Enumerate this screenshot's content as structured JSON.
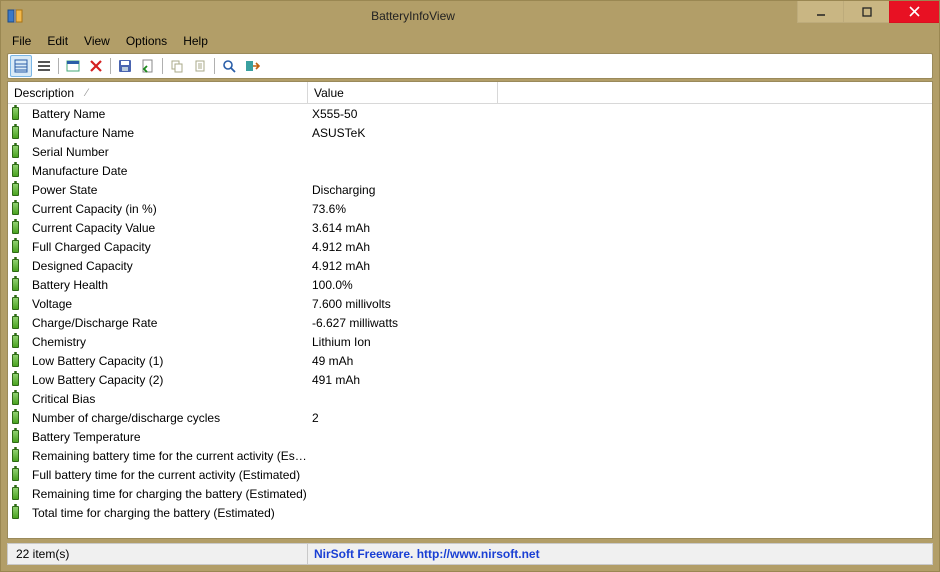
{
  "window": {
    "title": "BatteryInfoView"
  },
  "menu": {
    "file": "File",
    "edit": "Edit",
    "view": "View",
    "options": "Options",
    "help": "Help"
  },
  "columns": {
    "description": "Description",
    "value": "Value"
  },
  "rows": [
    {
      "desc": "Battery Name",
      "val": "X555-50"
    },
    {
      "desc": "Manufacture Name",
      "val": "ASUSTeK"
    },
    {
      "desc": "Serial Number",
      "val": ""
    },
    {
      "desc": "Manufacture Date",
      "val": ""
    },
    {
      "desc": "Power State",
      "val": "Discharging"
    },
    {
      "desc": "Current Capacity (in %)",
      "val": "73.6%"
    },
    {
      "desc": "Current Capacity Value",
      "val": "3.614 mAh"
    },
    {
      "desc": "Full Charged Capacity",
      "val": "4.912 mAh"
    },
    {
      "desc": "Designed Capacity",
      "val": "4.912 mAh"
    },
    {
      "desc": "Battery Health",
      "val": "100.0%"
    },
    {
      "desc": "Voltage",
      "val": "7.600 millivolts"
    },
    {
      "desc": "Charge/Discharge Rate",
      "val": "-6.627 milliwatts"
    },
    {
      "desc": "Chemistry",
      "val": "Lithium Ion"
    },
    {
      "desc": "Low Battery Capacity (1)",
      "val": "49 mAh"
    },
    {
      "desc": "Low Battery Capacity (2)",
      "val": "491 mAh"
    },
    {
      "desc": "Critical Bias",
      "val": ""
    },
    {
      "desc": "Number of charge/discharge cycles",
      "val": "2"
    },
    {
      "desc": "Battery Temperature",
      "val": ""
    },
    {
      "desc": "Remaining battery time for the current activity (Est...",
      "val": ""
    },
    {
      "desc": "Full battery time for the current activity (Estimated)",
      "val": ""
    },
    {
      "desc": "Remaining time for charging the battery (Estimated)",
      "val": ""
    },
    {
      "desc": "Total  time for charging the battery (Estimated)",
      "val": ""
    }
  ],
  "status": {
    "left": "22 item(s)",
    "right_text": "NirSoft Freeware.  http://www.nirsoft.net"
  }
}
